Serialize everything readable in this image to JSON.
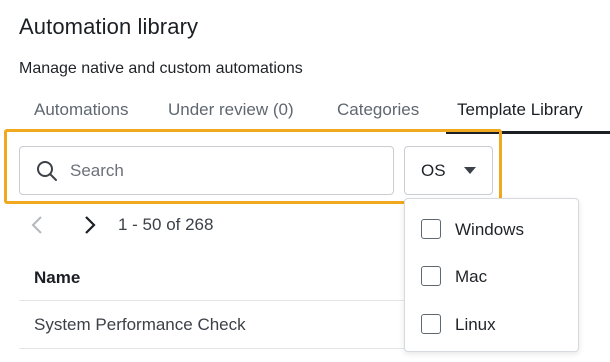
{
  "header": {
    "title": "Automation library",
    "subtitle": "Manage native and custom automations"
  },
  "tabs": [
    {
      "label": "Automations",
      "active": false
    },
    {
      "label": "Under review (0)",
      "active": false
    },
    {
      "label": "Categories",
      "active": false
    },
    {
      "label": "Template Library",
      "active": true
    }
  ],
  "filters": {
    "search_placeholder": "Search",
    "search_value": "",
    "os_label": "OS",
    "os_options": [
      {
        "label": "Windows",
        "checked": false
      },
      {
        "label": "Mac",
        "checked": false
      },
      {
        "label": "Linux",
        "checked": false
      }
    ]
  },
  "pagination": {
    "range_text": "1 - 50 of 268"
  },
  "table": {
    "columns": [
      "Name"
    ],
    "rows": [
      {
        "name": "System Performance Check"
      }
    ]
  },
  "colors": {
    "highlight": "#f0a81e",
    "active_tab": "#1b1f24",
    "inactive_tab": "#5f6770",
    "border": "#c9cdd2"
  },
  "icons": [
    "search-icon",
    "chevron-left-icon",
    "chevron-right-icon",
    "caret-down-icon",
    "checkbox-icon"
  ]
}
